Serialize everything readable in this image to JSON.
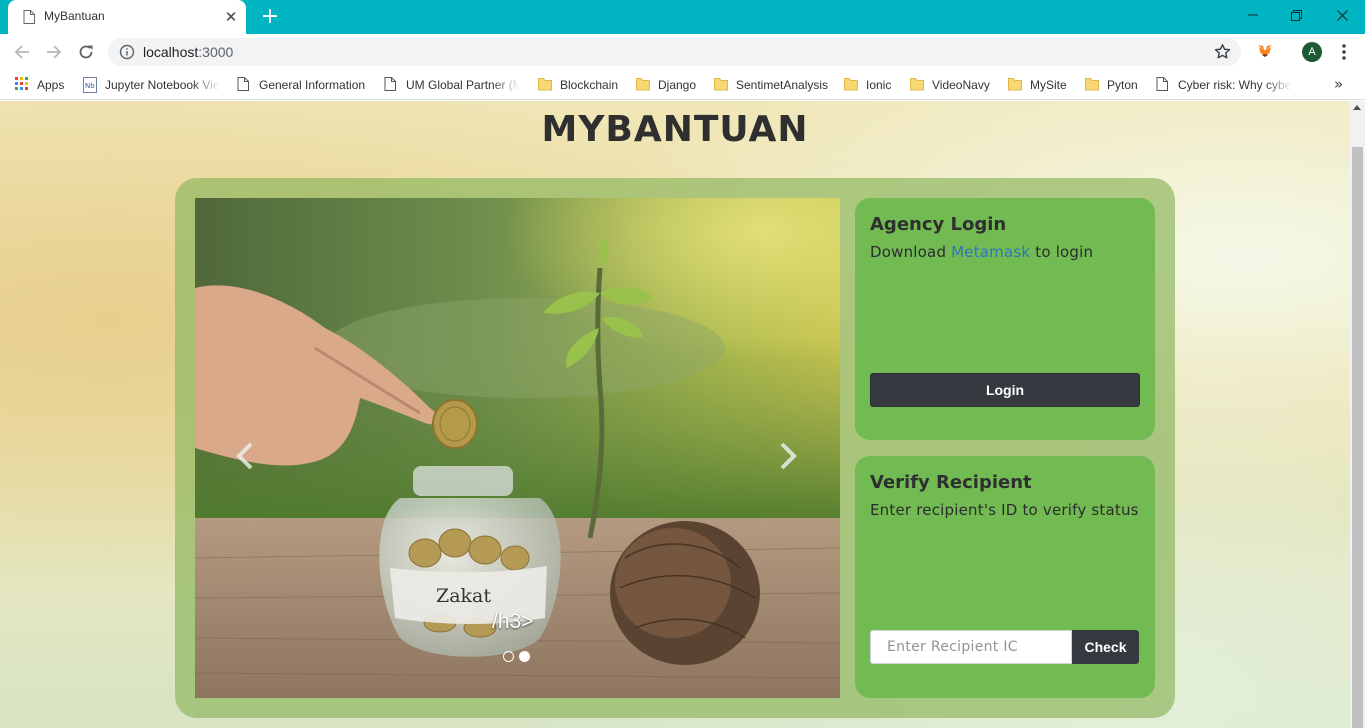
{
  "browser": {
    "tab_title": "MyBantuan",
    "url_host": "localhost",
    "url_port": ":3000",
    "avatar_letter": "A",
    "bookmarks": [
      {
        "label": "Apps",
        "icon": "apps-grid-icon"
      },
      {
        "label": "Jupyter Notebook Vie",
        "icon": "jupyter-icon"
      },
      {
        "label": "General Information",
        "icon": "page-icon"
      },
      {
        "label": "UM Global Partner (M",
        "icon": "page-icon"
      },
      {
        "label": "Blockchain",
        "icon": "folder-icon"
      },
      {
        "label": "Django",
        "icon": "folder-icon"
      },
      {
        "label": "SentimetAnalysis",
        "icon": "folder-icon"
      },
      {
        "label": "Ionic",
        "icon": "folder-icon"
      },
      {
        "label": "VideoNavy",
        "icon": "folder-icon"
      },
      {
        "label": "MySite",
        "icon": "folder-icon"
      },
      {
        "label": "Pyton",
        "icon": "folder-icon"
      },
      {
        "label": "Cyber risk: Why cyber",
        "icon": "page-icon"
      }
    ],
    "more_label": "»"
  },
  "page": {
    "title": "MYBANTUAN",
    "carousel": {
      "image_label": "Zakat",
      "caption": "/h3>",
      "slide_count": 2,
      "active_slide": 2
    },
    "agency_card": {
      "title": "Agency Login",
      "text_before": "Download ",
      "link_text": "Metamask",
      "text_after": " to login",
      "button_label": "Login"
    },
    "verify_card": {
      "title": "Verify Recipient",
      "text": "Enter recipient's ID to verify status",
      "input_placeholder": "Enter Recipient IC",
      "input_value": "",
      "button_label": "Check"
    }
  },
  "colors": {
    "tab_strip": "#00b4c2",
    "card_green": "#72bb53",
    "container_green": "#92b862",
    "button_dark": "#343a40",
    "link_blue": "#2e74c8"
  }
}
